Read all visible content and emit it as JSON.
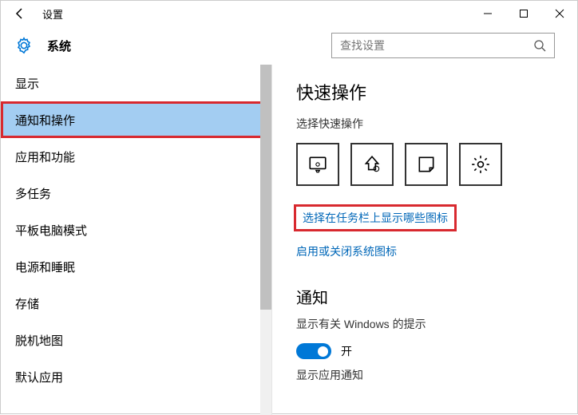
{
  "titlebar": {
    "title": "设置"
  },
  "header": {
    "category": "系统",
    "search_placeholder": "查找设置"
  },
  "sidebar": {
    "items": [
      {
        "label": "显示",
        "selected": false
      },
      {
        "label": "通知和操作",
        "selected": true,
        "highlighted": true
      },
      {
        "label": "应用和功能",
        "selected": false
      },
      {
        "label": "多任务",
        "selected": false
      },
      {
        "label": "平板电脑模式",
        "selected": false
      },
      {
        "label": "电源和睡眠",
        "selected": false
      },
      {
        "label": "存储",
        "selected": false
      },
      {
        "label": "脱机地图",
        "selected": false
      },
      {
        "label": "默认应用",
        "selected": false
      }
    ]
  },
  "main": {
    "quick_actions_heading": "快速操作",
    "quick_actions_sub": "选择快速操作",
    "tiles": [
      {
        "name": "tablet-mode-tile"
      },
      {
        "name": "connect-tile"
      },
      {
        "name": "note-tile"
      },
      {
        "name": "settings-tile"
      }
    ],
    "link_taskbar_icons": "选择在任务栏上显示哪些图标",
    "link_system_icons": "启用或关闭系统图标",
    "notifications_heading": "通知",
    "tips_label": "显示有关 Windows 的提示",
    "tips_toggle_state": "开",
    "app_notifications_label": "显示应用通知"
  }
}
